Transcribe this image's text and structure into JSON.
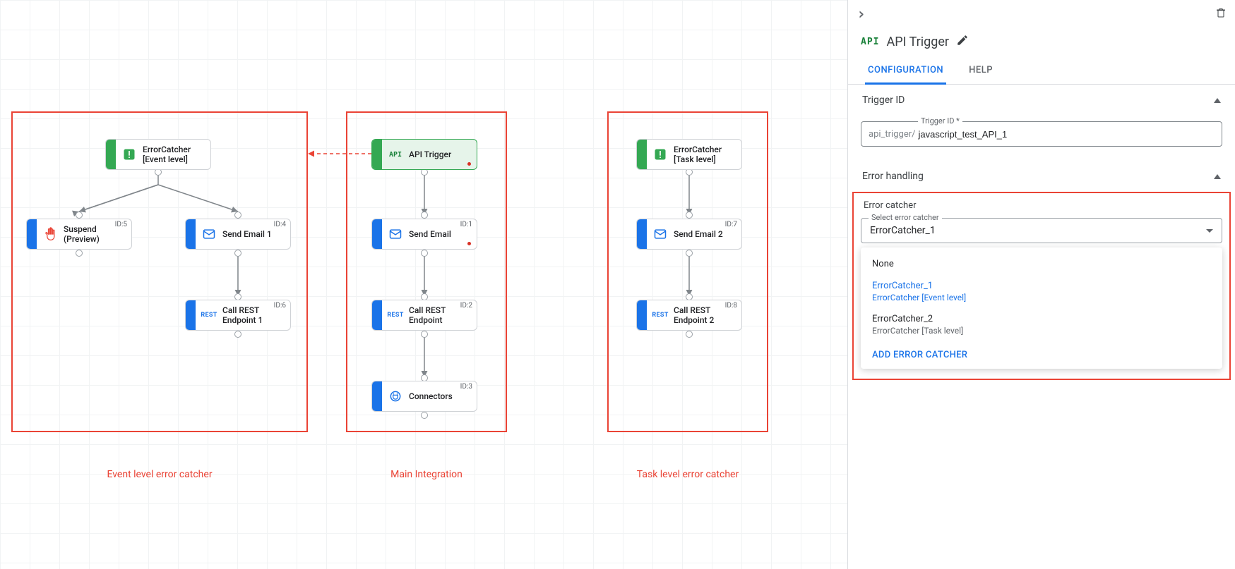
{
  "canvas": {
    "groups": {
      "event": {
        "label": "Event level error catcher"
      },
      "main": {
        "label": "Main Integration"
      },
      "task": {
        "label": "Task level error catcher"
      }
    },
    "nodes": {
      "ec_event": {
        "title": "ErrorCatcher\n[Event level]"
      },
      "suspend": {
        "title": "Suspend\n(Preview)",
        "id": "ID:5"
      },
      "send_email_1": {
        "title": "Send Email 1",
        "id": "ID:4"
      },
      "rest_1": {
        "title": "Call REST\nEndpoint 1",
        "id": "ID:6"
      },
      "api_trigger": {
        "title": "API Trigger"
      },
      "send_email": {
        "title": "Send Email",
        "id": "ID:1"
      },
      "rest": {
        "title": "Call REST\nEndpoint",
        "id": "ID:2"
      },
      "connectors": {
        "title": "Connectors",
        "id": "ID:3"
      },
      "ec_task": {
        "title": "ErrorCatcher\n[Task level]"
      },
      "send_email_2": {
        "title": "Send Email 2",
        "id": "ID:7"
      },
      "rest_2": {
        "title": "Call REST\nEndpoint 2",
        "id": "ID:8"
      }
    }
  },
  "panel": {
    "title": "API Trigger",
    "api_badge": "API",
    "tabs": {
      "config": "CONFIGURATION",
      "help": "HELP"
    },
    "sections": {
      "trigger_id": {
        "title": "Trigger ID",
        "legend": "Trigger ID *",
        "prefix": "api_trigger/",
        "value": "javascript_test_API_1"
      },
      "error_handling": {
        "title": "Error handling",
        "catcher_label": "Error catcher",
        "select_legend": "Select error catcher",
        "select_value": "ErrorCatcher_1",
        "options": [
          {
            "main": "None",
            "sub": null,
            "selected": false
          },
          {
            "main": "ErrorCatcher_1",
            "sub": "ErrorCatcher [Event level]",
            "selected": true
          },
          {
            "main": "ErrorCatcher_2",
            "sub": "ErrorCatcher [Task level]",
            "selected": false
          }
        ],
        "add_action": "ADD ERROR CATCHER"
      }
    }
  }
}
